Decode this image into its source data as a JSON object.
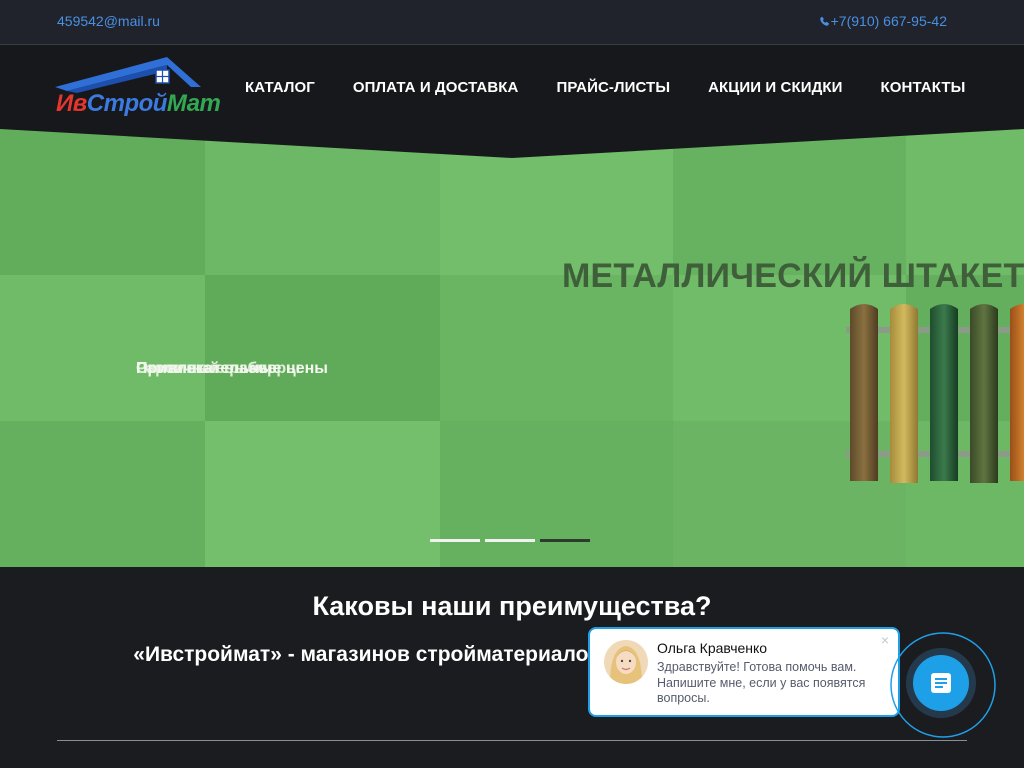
{
  "topbar": {
    "email": "459542@mail.ru",
    "phone": "+7(910) 667-95-42"
  },
  "logo": {
    "part1": "Ив",
    "part2": "Строй",
    "part3": "Мат"
  },
  "nav": [
    "КАТАЛОГ",
    "ОПЛАТА И ДОСТАВКА",
    "ПРАЙС-ЛИСТЫ",
    "АКЦИИ И СКИДКИ",
    "КОНТАКТЫ"
  ],
  "hero": {
    "title": "МЕТАЛЛИЧЕСКИЙ ШТАКЕТНИК",
    "caption_layers": [
      "Огромный выбор",
      "Различные размеры",
      "Привлекательные цены"
    ],
    "slides_count": 3,
    "active_slide": 3
  },
  "advantages": {
    "title": "Каковы наши преимущества?",
    "text": "«Ивстроймат» - магазинов стройматериалов во Владимирской области."
  },
  "chat": {
    "name": "Ольга Кравченко",
    "message": "Здравствуйте! Готова помочь вам. Напишите мне, если у вас появятся вопросы.",
    "close": "×"
  },
  "colors": {
    "link": "#4a90e2",
    "hero_green": "#6ab463",
    "chat_blue": "#1ea0e8"
  },
  "icons": {
    "phone": "phone-icon",
    "chat": "chat-icon"
  }
}
